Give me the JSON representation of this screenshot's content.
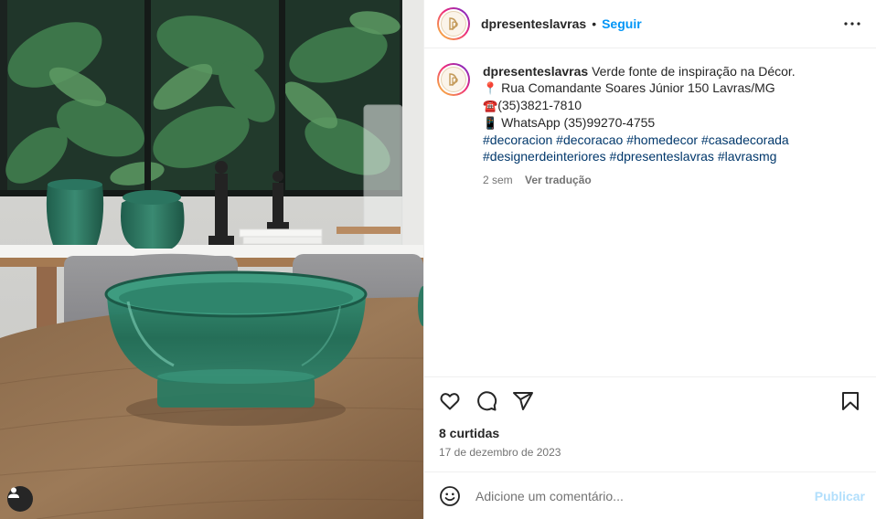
{
  "post": {
    "image_alt": "Tigela de vidro verde sobre mesa de madeira",
    "logo_monogram": "DP"
  },
  "header": {
    "username": "dpresenteslavras",
    "separator": "•",
    "follow_label": "Seguir"
  },
  "caption": {
    "username": "dpresenteslavras",
    "text": "Verde fonte de inspiração na Décor.",
    "address": "Rua Comandante Soares Júnior 150 Lavras/MG",
    "phone": "(35)3821-7810",
    "whatsapp": "WhatsApp (35)99270-4755",
    "hashtags_line1": [
      "#decoracion",
      "#decoracao",
      "#homedecor",
      "#casadecorada"
    ],
    "hashtags_line2": [
      "#designerdeinteriores",
      "#dpresenteslavras",
      "#lavrasmg"
    ],
    "time_ago": "2 sem",
    "translate_label": "Ver tradução"
  },
  "icons": {
    "pin": "📍",
    "phone": "☎️",
    "mobile": "📱"
  },
  "engagement": {
    "likes": "8 curtidas",
    "date": "17 de dezembro de 2023"
  },
  "comment": {
    "placeholder": "Adicione um comentário...",
    "publish_label": "Publicar"
  },
  "colors": {
    "link_blue": "#0095f6",
    "hashtag": "#00376b",
    "publish_disabled": "#b2dffc",
    "muted": "#737373"
  }
}
